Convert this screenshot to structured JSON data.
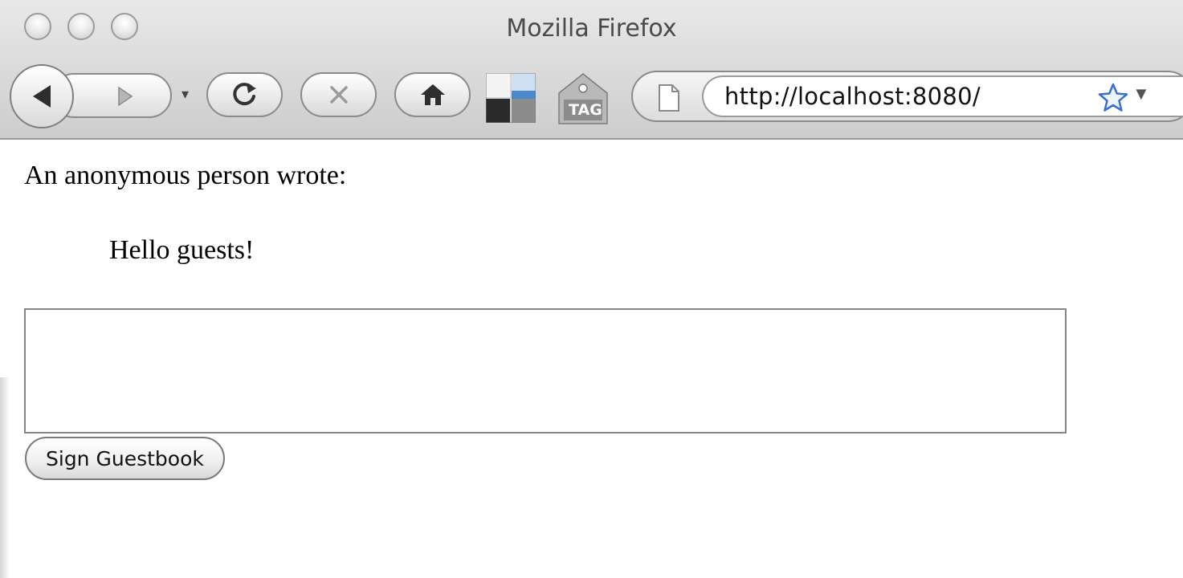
{
  "window": {
    "title": "Mozilla Firefox"
  },
  "toolbar": {
    "back_icon": "back-arrow-icon",
    "forward_icon": "forward-arrow-icon",
    "reload_icon": "reload-icon",
    "stop_icon": "stop-icon",
    "home_icon": "home-icon",
    "address": "http://localhost:8080/",
    "ext_tag_label": "TAG",
    "bookmark_icon": "star-icon"
  },
  "page": {
    "greeting_author": "An anonymous person wrote:",
    "greeting_message": "Hello guests!",
    "textarea_value": "",
    "submit_label": "Sign Guestbook"
  },
  "colors": {
    "chrome_bg": "#dcdcdc",
    "star_blue": "#3a6fd0",
    "ext_blue": "#4a88cc"
  }
}
